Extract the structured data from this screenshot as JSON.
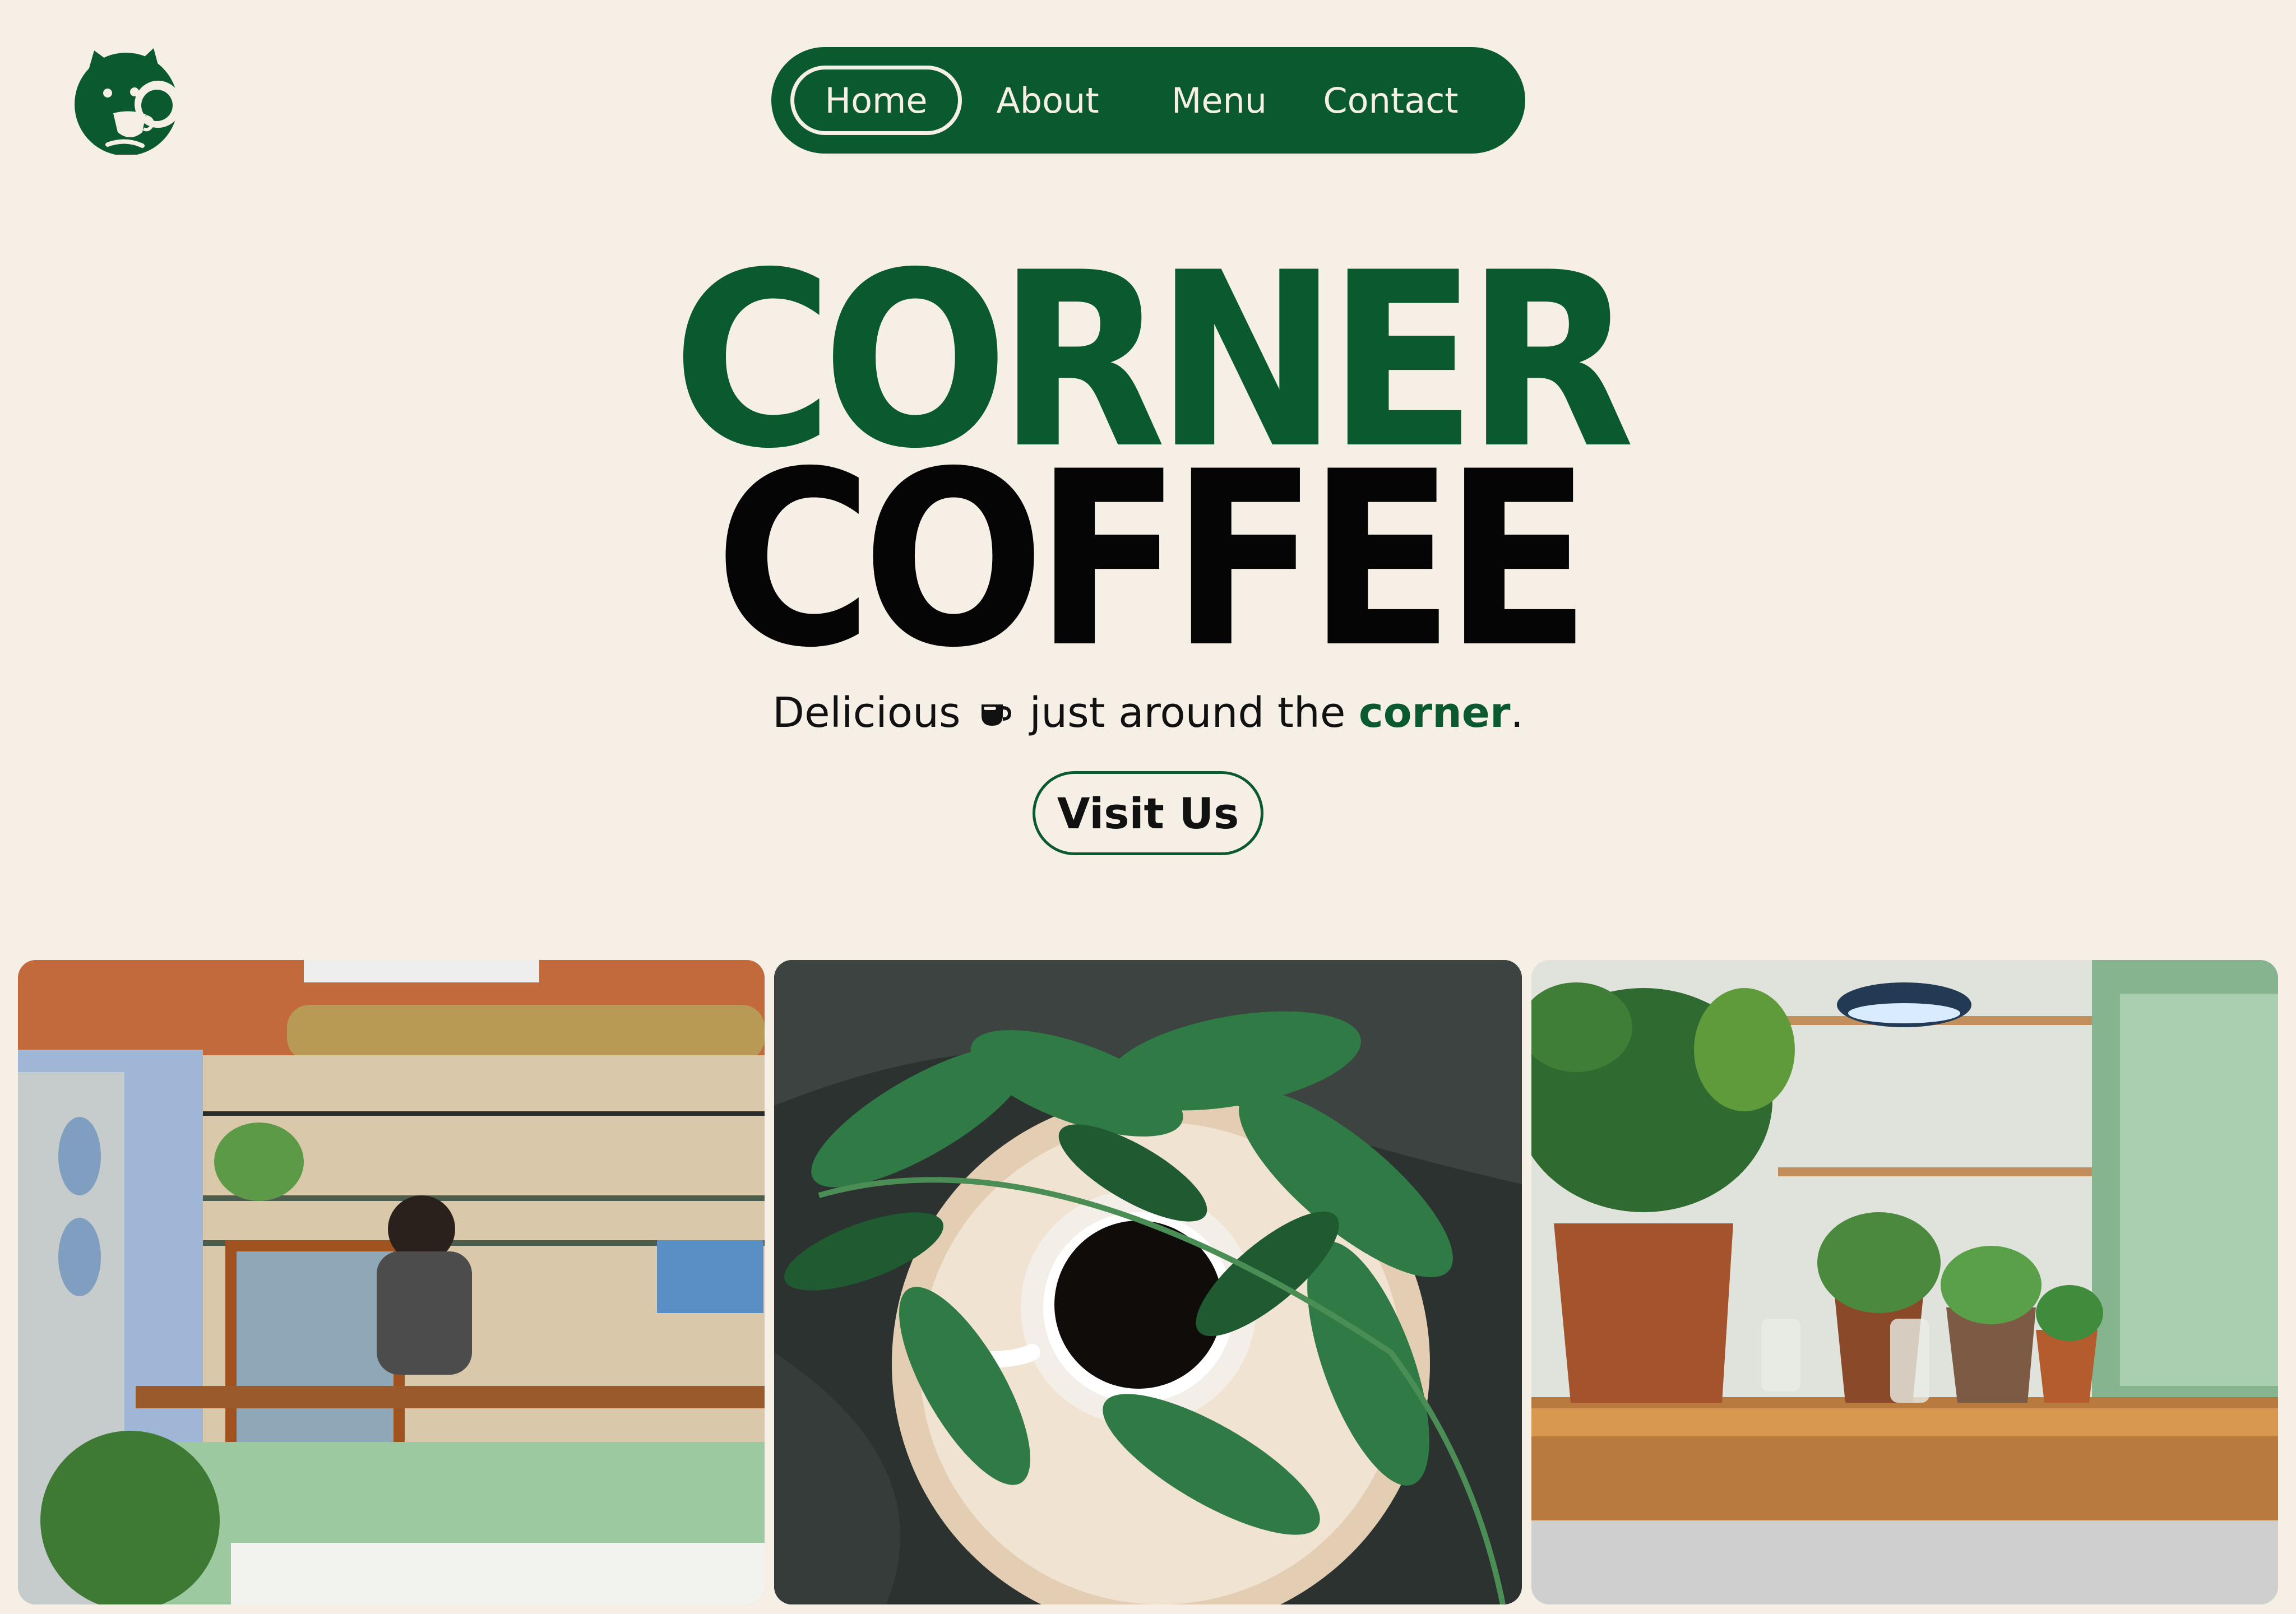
{
  "brand": {
    "logo_icon": "cat-with-coffee-cup-logo",
    "color": "#0b5a2f"
  },
  "nav": {
    "items": [
      {
        "label": "Home",
        "active": true
      },
      {
        "label": "About",
        "active": false
      },
      {
        "label": "Menu",
        "active": false
      },
      {
        "label": "Contact",
        "active": false
      }
    ]
  },
  "hero": {
    "title_line1": "CORNER",
    "title_line2": "COFFEE",
    "tagline_prefix": "Delicious",
    "tagline_icon": "coffee-cup-icon",
    "tagline_middle": "just around the",
    "tagline_accent": "corner",
    "tagline_suffix": ".",
    "cta_label": "Visit Us"
  },
  "gallery": [
    {
      "name": "cafe-interior-photo"
    },
    {
      "name": "coffee-cup-with-leaves-photo"
    },
    {
      "name": "plants-on-counter-photo"
    }
  ],
  "colors": {
    "background": "#f6efe6",
    "accent": "#0b5a2f",
    "text": "#111111"
  }
}
